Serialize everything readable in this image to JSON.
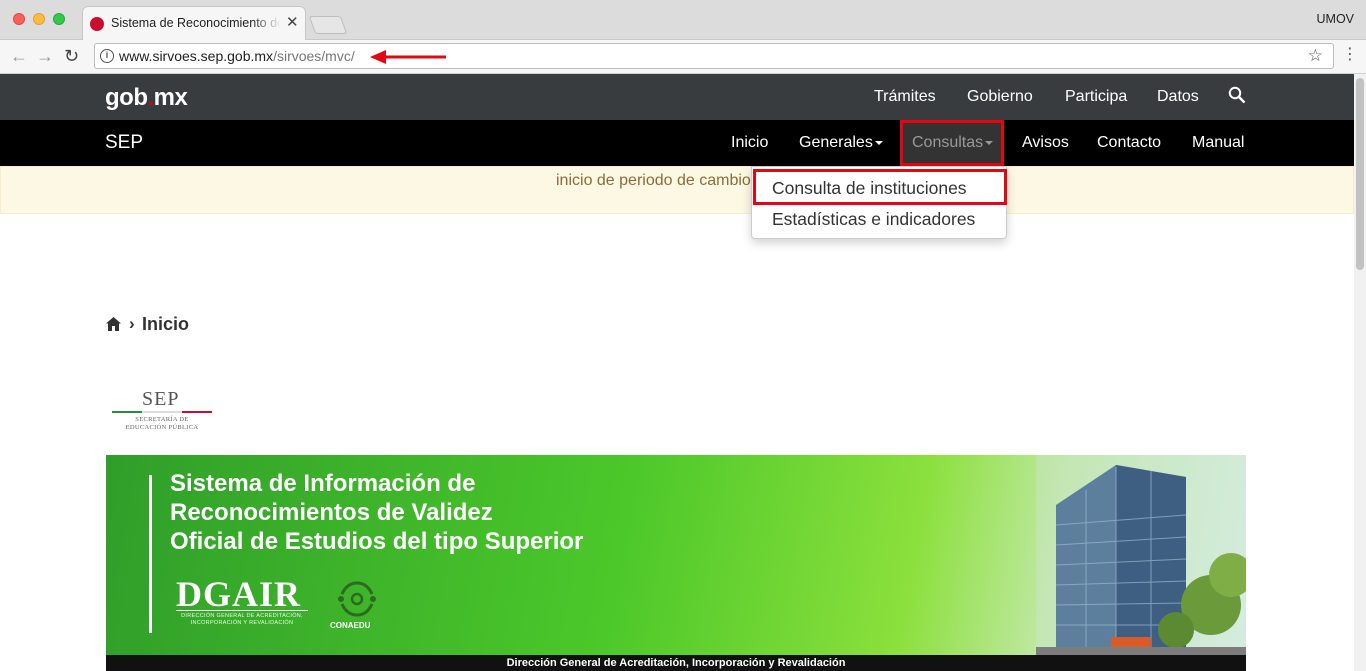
{
  "browser": {
    "tab_title": "Sistema de Reconocimiento de Validez Oficial de Estudios",
    "tab_close": "✕",
    "profile_name": "UMOV",
    "url_domain": "www.sirvoes.sep.gob.mx",
    "url_path": "/sirvoes/mvc/",
    "info_icon": "i",
    "back_glyph": "←",
    "forward_glyph": "→",
    "reload_glyph": "↻",
    "star_glyph": "☆",
    "menu_glyph": "⋮"
  },
  "gob_bar": {
    "logo_a": "gob",
    "logo_dot": ".",
    "logo_b": "mx",
    "links": [
      "Trámites",
      "Gobierno",
      "Participa",
      "Datos"
    ]
  },
  "sep_bar": {
    "brand": "SEP",
    "links": [
      "Inicio",
      "Generales",
      "Consultas",
      "Avisos",
      "Contacto",
      "Manual"
    ]
  },
  "alert": {
    "text": "inicio de periodo de cambios de la plataforma"
  },
  "dropdown": {
    "items": [
      "Consulta de instituciones",
      "Estadísticas e indicadores"
    ]
  },
  "breadcrumb": {
    "separator": "›",
    "current": "Inicio"
  },
  "sep_logo": {
    "title": "SEP",
    "line1": "SECRETARÍA DE",
    "line2": "EDUCACIÓN PÚBLICA"
  },
  "banner": {
    "title_lines": [
      "Sistema de Información de",
      "Reconocimientos de Validez",
      "Oficial de Estudios del tipo Superior"
    ],
    "dgair": "DGAIR",
    "dgair_line1": "DIRECCIÓN GENERAL DE ACREDITACIÓN,",
    "dgair_line2": "INCORPORACIÓN Y REVALIDACIÓN",
    "conaedu": "CONAEDU",
    "footer": "Dirección General de Acreditación, Incorporación y Revalidación"
  },
  "colors": {
    "gob_bar": "#393c3e",
    "sep_bar": "#000000",
    "annotation_red": "#e30613",
    "alert_bg": "#fcf8e3",
    "banner_green": "#4cc82a"
  },
  "icons": {
    "search": "search-icon",
    "home": "home-icon",
    "star": "star-icon",
    "info": "info-icon"
  }
}
